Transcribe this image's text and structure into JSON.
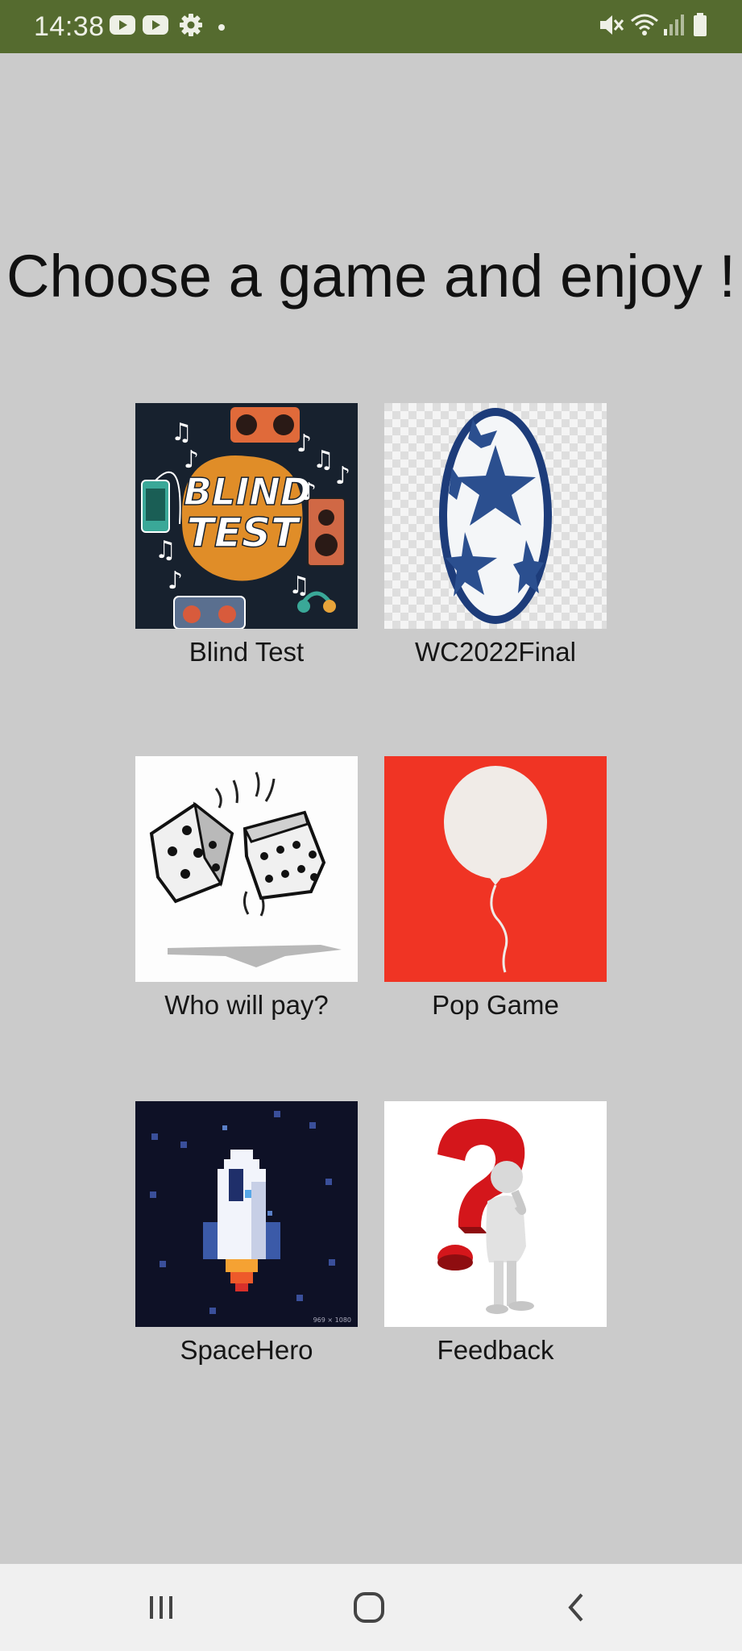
{
  "status_bar": {
    "time": "14:38",
    "left_icons": [
      "youtube-icon",
      "youtube-icon",
      "gear-icon",
      "dot-icon"
    ],
    "right_icons": [
      "mute-icon",
      "wifi-icon",
      "signal-icon",
      "battery-icon"
    ]
  },
  "page": {
    "title": "Choose a game and enjoy !"
  },
  "games": [
    {
      "label": "Blind Test",
      "thumb_text": [
        "BLIND",
        "TEST"
      ]
    },
    {
      "label": "WC2022Final"
    },
    {
      "label": "Who will pay?"
    },
    {
      "label": "Pop Game"
    },
    {
      "label": "SpaceHero",
      "watermark": "969 × 1080"
    },
    {
      "label": "Feedback"
    }
  ],
  "nav_bar": {
    "buttons": [
      "recent-apps-icon",
      "home-icon",
      "back-icon"
    ]
  },
  "colors": {
    "status_bar": "#556b2f",
    "background": "#cbcbcb",
    "nav_bar": "#f0f0f0",
    "pop_game_red": "#f03424"
  }
}
